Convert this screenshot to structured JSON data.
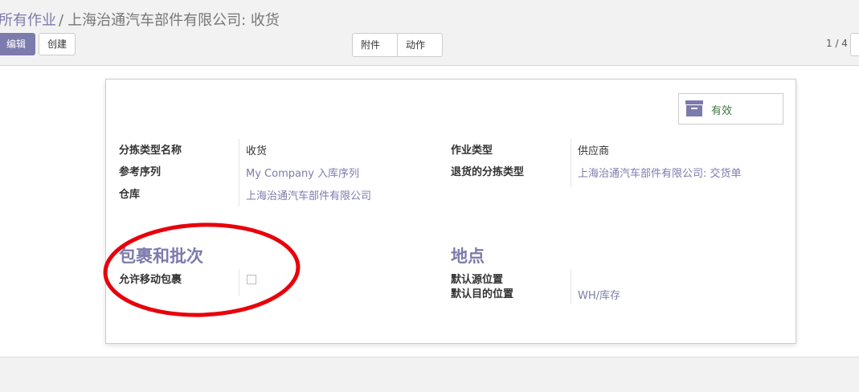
{
  "breadcrumb": {
    "parent": "所有作业",
    "separator": "/",
    "current": "上海治通汽车部件有限公司: 收货"
  },
  "toolbar": {
    "edit_label": "编辑",
    "create_label": "创建",
    "attachment_label": "附件",
    "action_label": "动作"
  },
  "pager": {
    "text": "1 / 4"
  },
  "status": {
    "label": "有效",
    "icon": "archive-box-icon"
  },
  "form": {
    "left_fields": [
      {
        "label": "分拣类型名称",
        "value": "收货"
      },
      {
        "label": "参考序列",
        "value": "My Company 入库序列"
      },
      {
        "label": "仓库",
        "value": "上海治通汽车部件有限公司"
      }
    ],
    "right_fields": [
      {
        "label": "作业类型",
        "value": "供应商"
      },
      {
        "label": "退货的分拣类型",
        "value": "上海治通汽车部件有限公司: 交货单"
      }
    ],
    "packages_section": {
      "title": "包裹和批次",
      "field_label": "允许移动包裹",
      "checked": false
    },
    "locations_section": {
      "title": "地点",
      "source_label": "默认源位置",
      "source_value": "",
      "dest_label": "默认目的位置",
      "dest_value": "WH/库存"
    }
  },
  "colors": {
    "brand": "#7c7bad",
    "status_active": "#3c763d",
    "annotation": "#e8000b"
  }
}
